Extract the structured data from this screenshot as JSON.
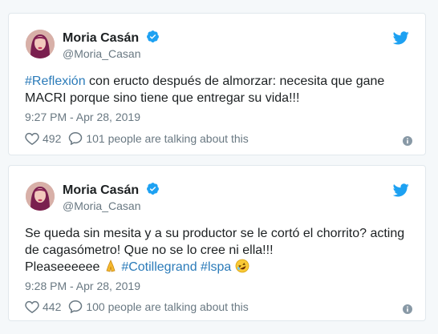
{
  "tweets": [
    {
      "author_name": "Moria Casán",
      "author_handle": "@Moria_Casan",
      "text_hashtag": "#Reflexión",
      "text_line1_rest": " con eructo después de almorzar: necesita que gane",
      "text_line2": "MACRI porque sino tiene que entregar su vida!!!",
      "timestamp": "9:27 PM - Apr 28, 2019",
      "likes": "492",
      "talking": "101 people are talking about this"
    },
    {
      "author_name": "Moria Casán",
      "author_handle": "@Moria_Casan",
      "text_line1": "Se queda sin mesita y a su productor se le cortó el chorrito? acting",
      "text_line2": "de cagasómetro! Que no se lo cree ni ella!!!",
      "text_line3_start": "Pleaseeeeee ",
      "hashtag1": "#Cotillegrand",
      "hashtag2": "#lspa",
      "timestamp": "9:28 PM - Apr 28, 2019",
      "likes": "442",
      "talking": "100 people are talking about this"
    }
  ],
  "colors": {
    "link": "#2b7bb9",
    "twitter_blue": "#1da1f2",
    "muted": "#697882",
    "border": "#e1e8ed"
  },
  "icons": [
    "verified-badge-icon",
    "twitter-bird-icon",
    "heart-icon",
    "speech-bubble-icon",
    "info-icon",
    "folded-hands-emoji",
    "rofl-emoji"
  ]
}
